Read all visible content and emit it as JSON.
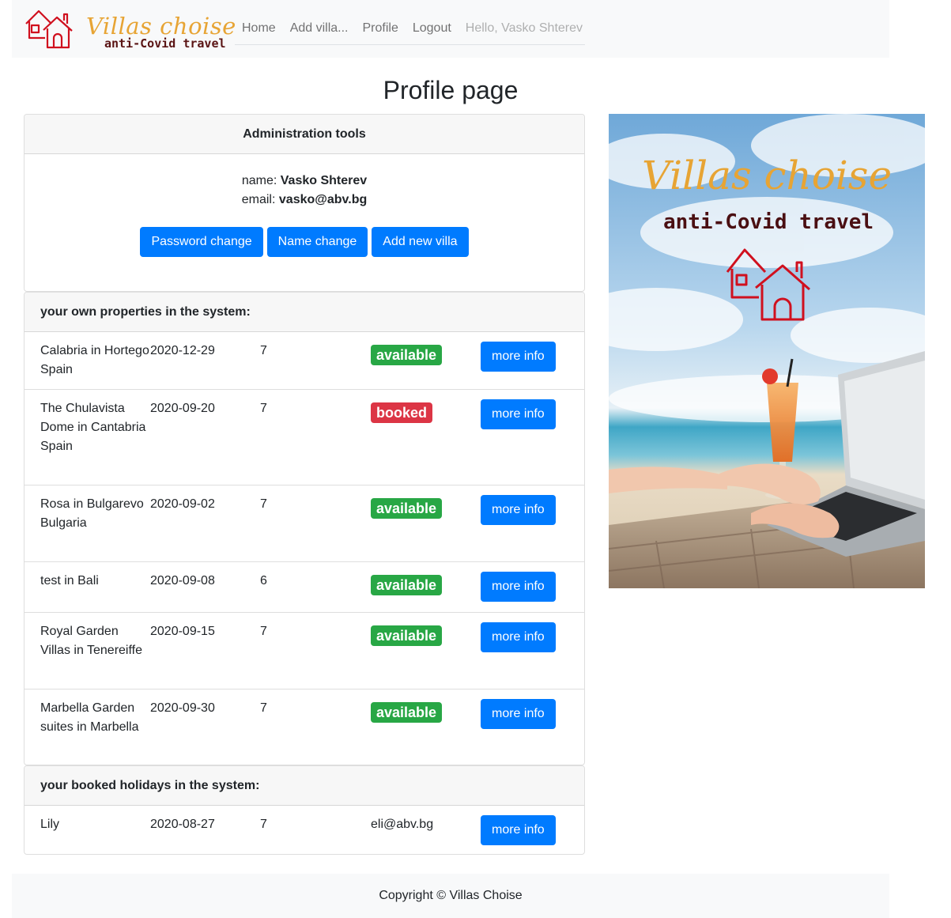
{
  "brand": {
    "title": "Villas choise",
    "subtitle": "anti-Covid travel"
  },
  "nav": {
    "items": [
      "Home",
      "Add villa...",
      "Profile",
      "Logout"
    ],
    "greeting": "Hello, Vasko Shterev"
  },
  "page": {
    "title": "Profile page"
  },
  "admin": {
    "header": "Administration tools",
    "name_label": "name:",
    "name_value": "Vasko Shterev",
    "email_label": "email:",
    "email_value": "vasko@abv.bg",
    "buttons": [
      "Password change",
      "Name change",
      "Add new villa"
    ]
  },
  "properties": {
    "header": "your own properties in the system:",
    "rows": [
      {
        "name": "Calabria in Hortego Spain",
        "date": "2020-12-29",
        "count": "7",
        "status": "available",
        "action": "more info"
      },
      {
        "name": "The Chulavista Dome in Cantabria Spain",
        "date": "2020-09-20",
        "count": "7",
        "status": "booked",
        "action": "more info"
      },
      {
        "name": "Rosa in Bulgarevo Bulgaria",
        "date": "2020-09-02",
        "count": "7",
        "status": "available",
        "action": "more info"
      },
      {
        "name": "test in Bali",
        "date": "2020-09-08",
        "count": "6",
        "status": "available",
        "action": "more info"
      },
      {
        "name": "Royal Garden Villas in Tenereiffe",
        "date": "2020-09-15",
        "count": "7",
        "status": "available",
        "action": "more info"
      },
      {
        "name": "Marbella Garden suites in Marbella",
        "date": "2020-09-30",
        "count": "7",
        "status": "available",
        "action": "more info"
      }
    ]
  },
  "booked": {
    "header": "your booked holidays in the system:",
    "rows": [
      {
        "name": "Lily",
        "date": "2020-08-27",
        "count": "7",
        "email": "eli@abv.bg",
        "action": "more info"
      }
    ]
  },
  "poster": {
    "title": "Villas choise",
    "subtitle": "anti-Covid travel"
  },
  "footer": {
    "text": "Copyright © Villas Choise"
  },
  "colors": {
    "primary": "#007bff",
    "success": "#28a745",
    "danger": "#dc3545",
    "brand_gold": "#e7a434",
    "brand_dark": "#5a1414",
    "house_red": "#d0101e"
  }
}
